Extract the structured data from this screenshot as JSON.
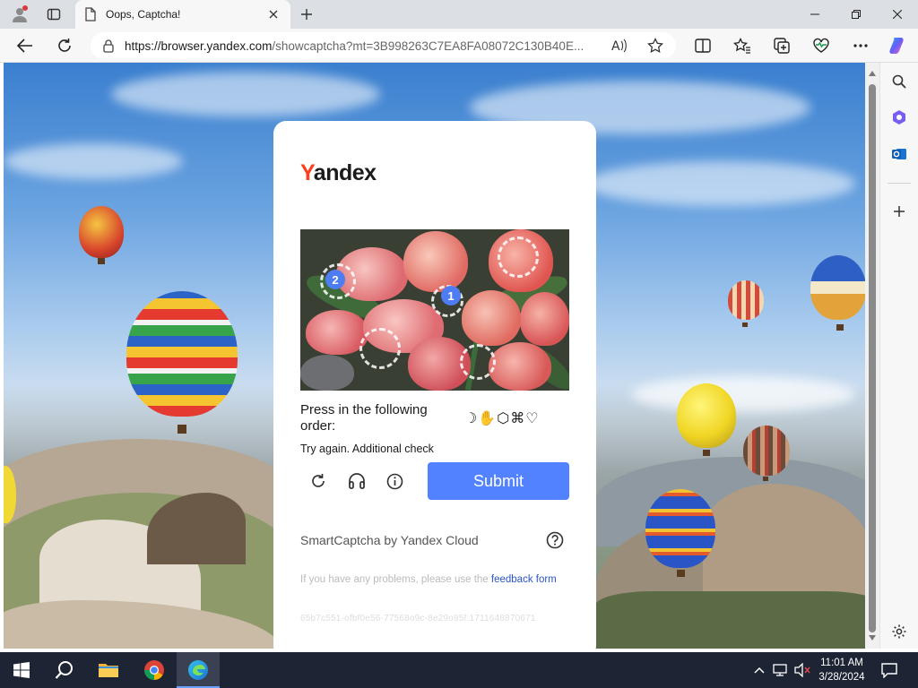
{
  "browser": {
    "tab_title": "Oops, Captcha!",
    "url_host": "https://browser.yandex.com",
    "url_rest": "/showcaptcha?mt=3B998263C7EA8FA08072C130B40E..."
  },
  "captcha": {
    "logo_first": "Y",
    "logo_rest": "andex",
    "marker_1": "1",
    "marker_2": "2",
    "instruction": "Press in the following order:",
    "order_icons": "☽✋⬡⌘♡",
    "retry_message": "Try again. Additional check",
    "submit_label": "Submit",
    "footer_brand": "SmartCaptcha by Yandex Cloud",
    "problem_text": "If you have any problems, please use the ",
    "feedback_link": "feedback form",
    "request_id": "65b7c551-ofbf0e56-77568o9c-8e29o95f:1711648870671"
  },
  "taskbar": {
    "time": "11:01 AM",
    "date": "3/28/2024"
  },
  "colors": {
    "accent": "#5282ff",
    "yandex_red": "#fc3f1d",
    "taskbar_bg": "#1d2433"
  },
  "icons": {
    "profile": "profile-icon",
    "workspaces": "workspaces-icon",
    "tab": "page-icon",
    "close": "close-icon",
    "new_tab": "plus-icon",
    "back": "back-arrow-icon",
    "refresh": "refresh-icon",
    "lock": "lock-icon",
    "read_aloud": "read-aloud-icon",
    "favorite": "star-icon",
    "split": "split-screen-icon",
    "favorites": "favorites-icon",
    "collections": "collections-icon",
    "performance": "heart-pulse-icon",
    "more": "more-icon",
    "copilot": "copilot-icon",
    "search": "search-icon",
    "audio": "headphones-icon",
    "info": "info-icon",
    "help": "help-icon",
    "settings": "gear-icon"
  }
}
